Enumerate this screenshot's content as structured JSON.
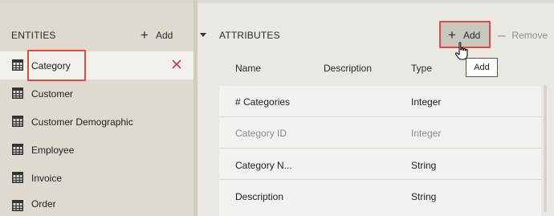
{
  "entities_panel": {
    "title": "ENTITIES",
    "add_label": "Add",
    "items": [
      {
        "label": "Category",
        "selected": true
      },
      {
        "label": "Customer",
        "selected": false
      },
      {
        "label": "Customer Demographic",
        "selected": false
      },
      {
        "label": "Employee",
        "selected": false
      },
      {
        "label": "Invoice",
        "selected": false
      },
      {
        "label": "Order",
        "selected": false
      }
    ]
  },
  "attributes_panel": {
    "title": "ATTRIBUTES",
    "add_label": "Add",
    "remove_label": "Remove",
    "tooltip": "Add",
    "columns": [
      "Name",
      "Description",
      "Type"
    ],
    "rows": [
      {
        "name": "# Categories",
        "description": "",
        "type": "Integer",
        "muted": false
      },
      {
        "name": "Category ID",
        "description": "",
        "type": "Integer",
        "muted": true
      },
      {
        "name": "Category N...",
        "description": "",
        "type": "String",
        "muted": false
      },
      {
        "name": "Description",
        "description": "",
        "type": "String",
        "muted": false
      }
    ]
  },
  "colors": {
    "left_bg": "#dedad0",
    "right_bg": "#ebe8e3",
    "highlight_red": "#e04b3f",
    "delete_red": "#c2403a",
    "muted_text": "#8c8c8c"
  },
  "icons": {
    "entity": "table-icon",
    "add": "plus-icon",
    "remove": "minus-icon",
    "delete": "close-icon",
    "collapse": "caret-down-icon",
    "cursor": "hand-pointer-icon"
  }
}
